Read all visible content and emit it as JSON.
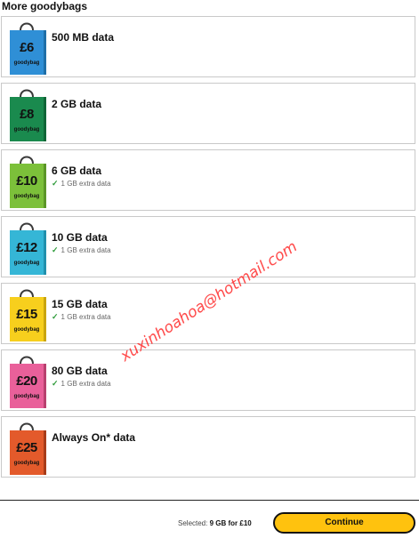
{
  "heading": "More goodybags",
  "bag_label": "goodybag",
  "cards": [
    {
      "price": "£6",
      "title": "500 MB data",
      "extra": "",
      "color": "#2f8fd6"
    },
    {
      "price": "£8",
      "title": "2 GB data",
      "extra": "",
      "color": "#1a8a4e"
    },
    {
      "price": "£10",
      "title": "6 GB data",
      "extra": "1 GB extra data",
      "color": "#7cc03a"
    },
    {
      "price": "£12",
      "title": "10 GB data",
      "extra": "1 GB extra data",
      "color": "#35b6d6"
    },
    {
      "price": "£15",
      "title": "15 GB data",
      "extra": "1 GB extra data",
      "color": "#f7cf1d"
    },
    {
      "price": "£20",
      "title": "80 GB data",
      "extra": "1 GB extra data",
      "color": "#e9609a"
    },
    {
      "price": "£25",
      "title": "Always On* data",
      "extra": "",
      "color": "#e35a2b"
    }
  ],
  "footer": {
    "selected_prefix": "Selected:",
    "selected_value": "9 GB for £10",
    "continue_label": "Continue"
  },
  "watermark": "xuxinhoahoa@hotmail.com"
}
